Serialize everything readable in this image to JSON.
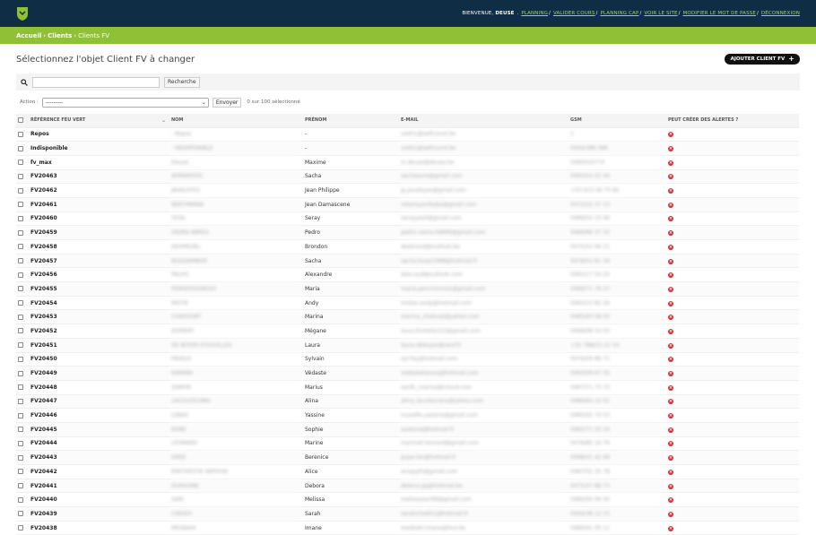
{
  "header": {
    "welcome_prefix": "BIENVENUE,",
    "username": "DEUSE",
    "links": [
      "PLANNING",
      "VALIDER COURS",
      "PLANNING CAP",
      "VOIR LE SITE",
      "MODIFIER LE MOT DE PASSE",
      "DÉCONNEXION"
    ],
    "brand_color": "#0f2d45",
    "accent_color": "#8fc136"
  },
  "breadcrumbs": {
    "home": "Accueil",
    "app": "Clients",
    "current": "Clients FV"
  },
  "page": {
    "title": "Sélectionnez l'objet Client FV à changer",
    "add_label": "AJOUTER CLIENT FV"
  },
  "search": {
    "value": "",
    "button": "Recherche"
  },
  "actions": {
    "label": "Action :",
    "selected": "---------",
    "go": "Envoyer",
    "counter": "0 sur 100 sélectionné"
  },
  "table": {
    "columns": [
      "RÉFÉRENCE FEU VERT",
      "NOM",
      "PRÉNOM",
      "E-MAIL",
      "GSM",
      "PEUT CRÉER DES ALERTES ?"
    ],
    "rows": [
      {
        "ref": "Repos",
        "nom": "- Repos",
        "prenom": "-",
        "email": "cedric@selfcount.be",
        "gsm": "1",
        "alert": "no"
      },
      {
        "ref": "Indisponible",
        "nom": "- INDISPONIBLE",
        "prenom": "-",
        "email": "cedric@selfcount.be",
        "gsm": "0456/386.386",
        "alert": "no"
      },
      {
        "ref": "fv_max",
        "nom": "Deuse",
        "prenom": "Maxime",
        "email": "m.deuse@deuse.be",
        "gsm": "0495010774",
        "alert": "no"
      },
      {
        "ref": "FV20463",
        "nom": "AVRAMOVIC",
        "prenom": "Sacha",
        "email": "sachaavra@gmail.com",
        "gsm": "0493/54 25 44",
        "alert": "no"
      },
      {
        "ref": "FV20462",
        "nom": "JAVALOYES",
        "prenom": "Jean Philippe",
        "email": "jp.javaloyes@gmail.com",
        "gsm": "+33 613 56 75 82",
        "alert": "no"
      },
      {
        "ref": "FV20461",
        "nom": "NDEYIMANA",
        "prenom": "Jean Damascene",
        "email": "ndiamyambaba@gmail.com",
        "gsm": "0472/22 37 13",
        "alert": "no"
      },
      {
        "ref": "FV20460",
        "nom": "YESIL",
        "prenom": "Seray",
        "email": "serayyesil@gmail.com",
        "gsm": "0489/54 23 46",
        "alert": "no"
      },
      {
        "ref": "FV20459",
        "nom": "VIEIRA ABREU",
        "prenom": "Pedro",
        "email": "pedro.vieira.04899@gmail.com",
        "gsm": "0489/86 37 32",
        "alert": "no"
      },
      {
        "ref": "FV20458",
        "nom": "DESMEDEL",
        "prenom": "Brondon",
        "email": "desbrand@outlook.be",
        "gsm": "0475/52 06 21",
        "alert": "no"
      },
      {
        "ref": "FV20457",
        "nom": "BUSSAIMBOR",
        "prenom": "Sacha",
        "email": "sacha.bussi1988@hotmail.fr",
        "gsm": "0478/52 81 34",
        "alert": "no"
      },
      {
        "ref": "FV20456",
        "nom": "PALIFE",
        "prenom": "Alexandre",
        "email": "Alex-sud@outlook.com",
        "gsm": "0492/17 54 25",
        "alert": "no"
      },
      {
        "ref": "FV20455",
        "nom": "PENVERGONCKX",
        "prenom": "Maria",
        "email": "maria.pencinonckx@gmail.com",
        "gsm": "0489/71 76 27",
        "alert": "no"
      },
      {
        "ref": "FV20454",
        "nom": "MOTIE",
        "prenom": "Andy",
        "email": "motse-andy@hotmail.com",
        "gsm": "0493/15 82 26",
        "alert": "no"
      },
      {
        "ref": "FV20453",
        "nom": "CHASSIVAT",
        "prenom": "Marina",
        "email": "marina_chalsval@yahoo.com",
        "gsm": "0485/60 58 02",
        "alert": "no"
      },
      {
        "ref": "FV20452",
        "nom": "DOMERT",
        "prenom": "Mégane",
        "email": "laura.fontella123@gmail.com",
        "gsm": "0468/08 53 05",
        "alert": "no"
      },
      {
        "ref": "FV20451",
        "nom": "DE BOYER D'EGUILLES",
        "prenom": "Laura",
        "email": "laura.deboyer@neuf.fr",
        "gsm": "+32 788/15 21 54",
        "alert": "no"
      },
      {
        "ref": "FV20450",
        "nom": "FAYAUX",
        "prenom": "Sylvain",
        "email": "syl-fay@hotmail.com",
        "gsm": "0476/09 86 71",
        "alert": "no"
      },
      {
        "ref": "FV20449",
        "nom": "KARARA",
        "prenom": "Védaste",
        "email": "vedastekarara@hotmail.com",
        "gsm": "0493/09 67 35",
        "alert": "no"
      },
      {
        "ref": "FV20448",
        "nom": "ZANFIR",
        "prenom": "Marius",
        "email": "zanfir_marius@icloud.com",
        "gsm": "0467/71 73 75",
        "alert": "no"
      },
      {
        "ref": "FV20447",
        "nom": "LACULESCANU",
        "prenom": "Alina",
        "email": "alina_laculescanu@yahoo.com",
        "gsm": "0486/64 22 61",
        "alert": "no"
      },
      {
        "ref": "FV20446",
        "nom": "LEBAS",
        "prenom": "Yassine",
        "email": "musafie.yassine@gmail.com",
        "gsm": "0485/02 74 53",
        "alert": "no"
      },
      {
        "ref": "FV20445",
        "nom": "KONE",
        "prenom": "Sophie",
        "email": "ssokone@hotmail.fr",
        "gsm": "0465/71 55 24",
        "alert": "no"
      },
      {
        "ref": "FV20444",
        "nom": "LÉONARD",
        "prenom": "Marine",
        "email": "marine0.leonard@gmail.com",
        "gsm": "0476/80 16 76",
        "alert": "no"
      },
      {
        "ref": "FV20443",
        "nom": "GREE",
        "prenom": "Berenice",
        "email": "pupe-lan@hotmail.fr",
        "gsm": "0498/41 42 68",
        "alert": "no"
      },
      {
        "ref": "FV20442",
        "nom": "EMITOESTIE NIPDIYAI",
        "prenom": "Alice",
        "email": "anispyth@gmail.com",
        "gsm": "0487/55 35 78",
        "alert": "no"
      },
      {
        "ref": "FV20441",
        "nom": "DURGONE",
        "prenom": "Debora",
        "email": "debora.gq@hotmail.be",
        "gsm": "0475/37 88 73",
        "alert": "no"
      },
      {
        "ref": "FV20440",
        "nom": "SARI",
        "prenom": "Melissa",
        "email": "melissasari08@gmail.com",
        "gsm": "0486/94 06 40",
        "alert": "no"
      },
      {
        "ref": "FV20439",
        "nom": "CHEIKH",
        "prenom": "Sarah",
        "email": "sarahcheikh1@hotmail.fr",
        "gsm": "0456/38 12 15",
        "alert": "no"
      },
      {
        "ref": "FV20438",
        "nom": "MESBAHI",
        "prenom": "Imane",
        "email": "mesbahi.imane@live.be",
        "gsm": "0489/41 05 11",
        "alert": "no"
      }
    ]
  }
}
